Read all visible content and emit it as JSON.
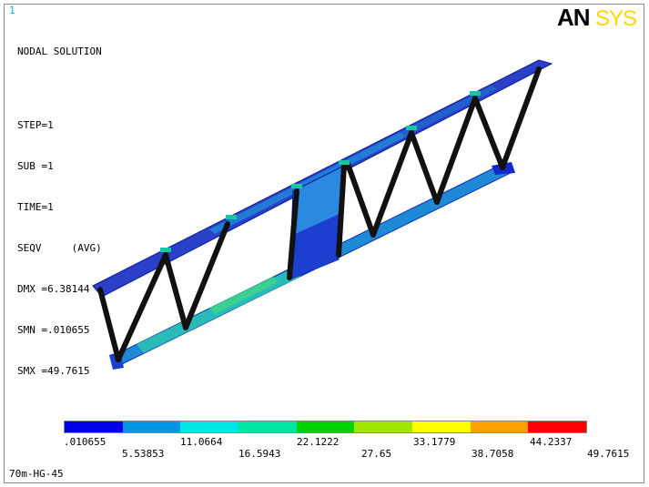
{
  "window": {
    "number": "1"
  },
  "brand": {
    "logo_text_a": "AN",
    "logo_text_b": "SYS"
  },
  "info": {
    "title": "NODAL SOLUTION",
    "lines": [
      "STEP=1",
      "SUB =1",
      "TIME=1",
      "SEQV     (AVG)",
      "DMX =6.38144",
      "SMN =.010655",
      "SMX =49.7615"
    ]
  },
  "legend": {
    "colors": [
      "#0000e6",
      "#0096e6",
      "#00e6e6",
      "#00e6a0",
      "#00d200",
      "#a0e600",
      "#ffff00",
      "#ffa000",
      "#ff0000"
    ],
    "labels_top": [
      ".010655",
      "11.0664",
      "22.1222",
      "33.1779",
      "44.2337"
    ],
    "labels_bottom": [
      "5.53853",
      "16.5943",
      "27.65",
      "38.7058",
      "49.7615"
    ]
  },
  "caption": "70m-HG-45"
}
